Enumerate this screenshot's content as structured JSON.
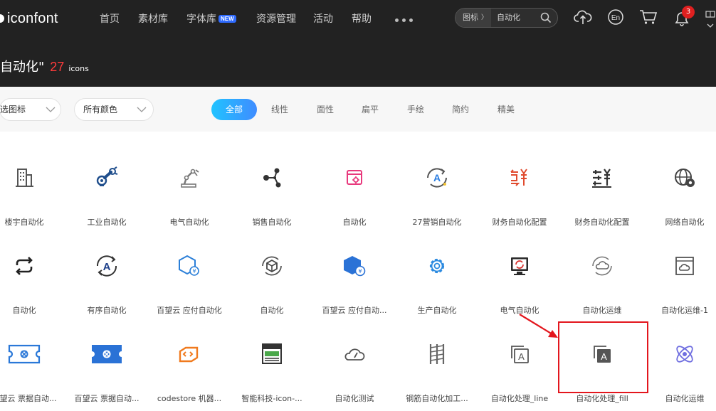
{
  "header": {
    "logo_text": "iconfont",
    "nav": [
      {
        "label": "首页"
      },
      {
        "label": "素材库"
      },
      {
        "label": "字体库",
        "badge": "NEW"
      },
      {
        "label": "资源管理"
      },
      {
        "label": "活动"
      },
      {
        "label": "帮助"
      }
    ],
    "search": {
      "type_label": "图标",
      "value": "自动化"
    },
    "notification_count": "3",
    "lang_icon": "En"
  },
  "result": {
    "query": "自动化\"",
    "count": "27",
    "unit": "icons"
  },
  "filters": {
    "select_1": "选图标",
    "select_2": "所有颜色",
    "tabs": [
      "全部",
      "线性",
      "面性",
      "扁平",
      "手绘",
      "简约",
      "精美"
    ],
    "active_tab": 0
  },
  "icons": [
    {
      "label": "楼宇自动化",
      "icon": "building-icon"
    },
    {
      "label": "工业自动化",
      "icon": "robot-arm-icon"
    },
    {
      "label": "电气自动化",
      "icon": "robot-arm-outline-icon"
    },
    {
      "label": "销售自动化",
      "icon": "share-nodes-icon"
    },
    {
      "label": "自动化",
      "icon": "browser-gear-icon"
    },
    {
      "label": "27营销自动化",
      "icon": "letter-a-cycle-icon"
    },
    {
      "label": "财务自动化配置",
      "icon": "yen-exchange-icon"
    },
    {
      "label": "财务自动化配置",
      "icon": "yen-sliders-icon"
    },
    {
      "label": "网络自动化",
      "icon": "globe-gear-icon"
    },
    {
      "label": "自动化",
      "icon": "loop-arrows-icon"
    },
    {
      "label": "有序自动化",
      "icon": "letter-a-circle-icon"
    },
    {
      "label": "百望云 应付自动化",
      "icon": "hexagon-yen-outline-icon"
    },
    {
      "label": "自动化",
      "icon": "box-cycle-icon"
    },
    {
      "label": "百望云 应付自动...",
      "icon": "hexagon-yen-fill-icon"
    },
    {
      "label": "生产自动化",
      "icon": "gear-icon"
    },
    {
      "label": "电气自动化",
      "icon": "monitor-cycle-icon"
    },
    {
      "label": "自动化运维",
      "icon": "cloud-cycle-icon"
    },
    {
      "label": "自动化运维-1",
      "icon": "window-cloud-icon"
    },
    {
      "label": "百望云 票据自动...",
      "icon": "ticket-outline-icon"
    },
    {
      "label": "百望云 票据自动...",
      "icon": "ticket-fill-icon"
    },
    {
      "label": "codestore 机器...",
      "icon": "code-card-icon"
    },
    {
      "label": "智能科技-icon-...",
      "icon": "machine-icon"
    },
    {
      "label": "自动化测试",
      "icon": "cloud-gauge-icon"
    },
    {
      "label": "钢筋自动化加工...",
      "icon": "rebar-icon"
    },
    {
      "label": "自动化处理_line",
      "icon": "stacked-a-line-icon"
    },
    {
      "label": "自动化处理_fill",
      "icon": "stacked-a-fill-icon"
    },
    {
      "label": "自动化运维",
      "icon": "atom-icon"
    }
  ]
}
